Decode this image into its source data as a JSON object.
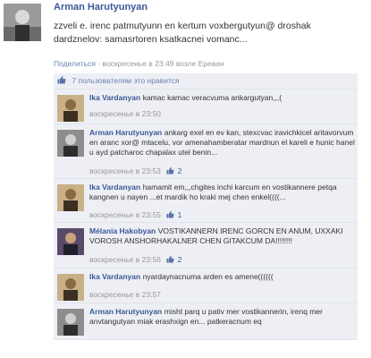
{
  "post": {
    "author": "Arman Harutyunyan",
    "text": "zzveli e. irenc patmutyunn en kertum voxbergutyun@ droshak dardznelov: samasrtoren ksatkacnei vomanc...",
    "actions": {
      "share": "Поделиться",
      "separator": "·",
      "time": "воскресенье в 23:49",
      "place": "возле Ереван"
    },
    "likes": "7 пользователям это нравится"
  },
  "comments": [
    {
      "author": "Ika Vardanyan",
      "text": "kamac kamac veracvuma ankargutyan,,,(",
      "time": "воскресенье в 23:50",
      "likes": ""
    },
    {
      "author": "Arman Harutyunyan",
      "text": "ankarg exel en ev kan, stexcvac iravichkicel aritavorvum en aranc xor@ mtacelu, vor amenahamberatar mardnun el kareli e hunic hanel u ayd patcharoc chapalax utel benin...",
      "time": "воскресенье в 23:53",
      "likes": "2"
    },
    {
      "author": "Ika Vardanyan",
      "text": "hamamit em,,,chgites inchi karcum en vostikannere petqa kangnen u nayen ...et mardik ho kraki mej chen enkel((((...",
      "time": "воскресенье в 23:55",
      "likes": "1"
    },
    {
      "author": "Mélania Hakobyan",
      "text": "VOSTIKANNERN IRENC GORCN EN ANUM, UXXAKI VOROSH ANSHORHAKALNER CHEN GITAKCUM DA!!!!!!!!",
      "time": "воскресенье в 23:56",
      "likes": "2"
    },
    {
      "author": "Ika Vardanyan",
      "text": "nyardaynacnuma arden es amene((((((",
      "time": "воскресенье в 23:57",
      "likes": ""
    },
    {
      "author": "Arman Harutyunyan",
      "text": "misht parq u pativ mer vostikannerin, irenq mer anvtangutyan miak erashxign en... patkeracnum eq",
      "time": "",
      "likes": ""
    }
  ]
}
